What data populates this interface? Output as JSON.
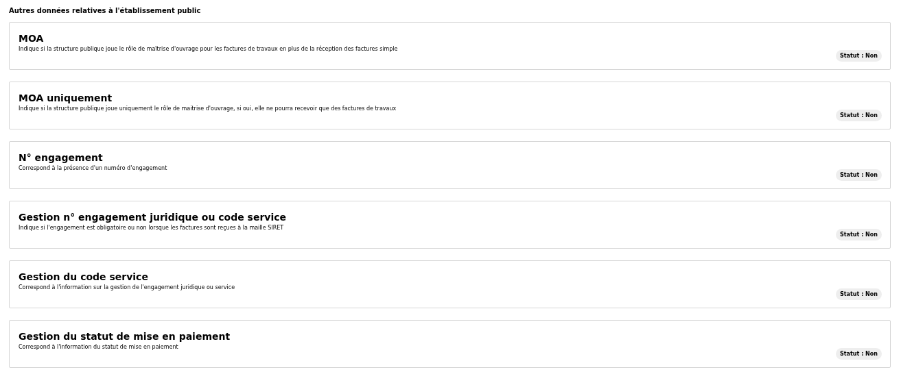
{
  "section_title": "Autres données relatives à l'établissement public",
  "cards": [
    {
      "title": "MOA",
      "description": "Indique si la structure publique joue le rôle de maîtrise d'ouvrage pour les factures de travaux en plus de la réception des factures simple",
      "status": "Statut : Non"
    },
    {
      "title": "MOA uniquement",
      "description": "Indique si la structure publique joue uniquement le rôle de maitrise d'ouvrage, si oui, elle ne pourra recevoir que des factures de travaux",
      "status": "Statut : Non"
    },
    {
      "title": "N° engagement",
      "description": "Correspond à la présence d'un numéro d'engagement",
      "status": "Statut : Non"
    },
    {
      "title": "Gestion n° engagement juridique ou code service",
      "description": "Indique si l'engagement est obligatoire ou non lorsque les factures sont reçues à la maille SIRET",
      "status": "Statut : Non"
    },
    {
      "title": "Gestion du code service",
      "description": "Correspond à l'information sur la gestion de l'engagement juridique ou service",
      "status": "Statut : Non"
    },
    {
      "title": "Gestion du statut de mise en paiement",
      "description": "Correspond à l'information du statut de mise en paiement",
      "status": "Statut : Non"
    }
  ]
}
